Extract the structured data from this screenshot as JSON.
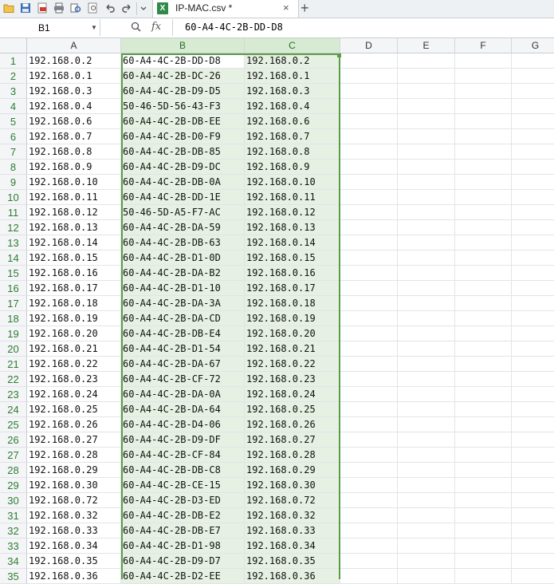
{
  "window": {
    "tab_title": "IP-MAC.csv *",
    "tab_close": "×",
    "new_tab": "+",
    "file_icon_letter": "X"
  },
  "toolbar": {
    "icons": [
      "open-folder-icon",
      "save-icon",
      "export-pdf-icon",
      "print-icon",
      "print-preview-icon",
      "find-icon",
      "undo-icon",
      "redo-icon",
      "more-dropdown-icon"
    ]
  },
  "formula_bar": {
    "name_box": "B1",
    "fx_label": "fx",
    "formula": "60-A4-4C-2B-DD-D8"
  },
  "columns": [
    "A",
    "B",
    "C",
    "D",
    "E",
    "F",
    "G"
  ],
  "selected_columns": [
    "B",
    "C"
  ],
  "rows": [
    {
      "n": "1",
      "a": "192.168.0.2",
      "b": "60-A4-4C-2B-DD-D8",
      "c": "192.168.0.2"
    },
    {
      "n": "2",
      "a": "192.168.0.1",
      "b": "60-A4-4C-2B-DC-26",
      "c": "192.168.0.1"
    },
    {
      "n": "3",
      "a": "192.168.0.3",
      "b": "60-A4-4C-2B-D9-D5",
      "c": "192.168.0.3"
    },
    {
      "n": "4",
      "a": "192.168.0.4",
      "b": "50-46-5D-56-43-F3",
      "c": "192.168.0.4"
    },
    {
      "n": "5",
      "a": "192.168.0.6",
      "b": "60-A4-4C-2B-DB-EE",
      "c": "192.168.0.6"
    },
    {
      "n": "6",
      "a": "192.168.0.7",
      "b": "60-A4-4C-2B-D0-F9",
      "c": "192.168.0.7"
    },
    {
      "n": "7",
      "a": "192.168.0.8",
      "b": "60-A4-4C-2B-DB-85",
      "c": "192.168.0.8"
    },
    {
      "n": "8",
      "a": "192.168.0.9",
      "b": "60-A4-4C-2B-D9-DC",
      "c": "192.168.0.9"
    },
    {
      "n": "9",
      "a": "192.168.0.10",
      "b": "60-A4-4C-2B-DB-0A",
      "c": "192.168.0.10"
    },
    {
      "n": "10",
      "a": "192.168.0.11",
      "b": "60-A4-4C-2B-DD-1E",
      "c": "192.168.0.11"
    },
    {
      "n": "11",
      "a": "192.168.0.12",
      "b": "50-46-5D-A5-F7-AC",
      "c": "192.168.0.12"
    },
    {
      "n": "12",
      "a": "192.168.0.13",
      "b": "60-A4-4C-2B-DA-59",
      "c": "192.168.0.13"
    },
    {
      "n": "13",
      "a": "192.168.0.14",
      "b": "60-A4-4C-2B-DB-63",
      "c": "192.168.0.14"
    },
    {
      "n": "14",
      "a": "192.168.0.15",
      "b": "60-A4-4C-2B-D1-0D",
      "c": "192.168.0.15"
    },
    {
      "n": "15",
      "a": "192.168.0.16",
      "b": "60-A4-4C-2B-DA-B2",
      "c": "192.168.0.16"
    },
    {
      "n": "16",
      "a": "192.168.0.17",
      "b": "60-A4-4C-2B-D1-10",
      "c": "192.168.0.17"
    },
    {
      "n": "17",
      "a": "192.168.0.18",
      "b": "60-A4-4C-2B-DA-3A",
      "c": "192.168.0.18"
    },
    {
      "n": "18",
      "a": "192.168.0.19",
      "b": "60-A4-4C-2B-DA-CD",
      "c": "192.168.0.19"
    },
    {
      "n": "19",
      "a": "192.168.0.20",
      "b": "60-A4-4C-2B-DB-E4",
      "c": "192.168.0.20"
    },
    {
      "n": "20",
      "a": "192.168.0.21",
      "b": "60-A4-4C-2B-D1-54",
      "c": "192.168.0.21"
    },
    {
      "n": "21",
      "a": "192.168.0.22",
      "b": "60-A4-4C-2B-DA-67",
      "c": "192.168.0.22"
    },
    {
      "n": "22",
      "a": "192.168.0.23",
      "b": "60-A4-4C-2B-CF-72",
      "c": "192.168.0.23"
    },
    {
      "n": "23",
      "a": "192.168.0.24",
      "b": "60-A4-4C-2B-DA-0A",
      "c": "192.168.0.24"
    },
    {
      "n": "24",
      "a": "192.168.0.25",
      "b": "60-A4-4C-2B-DA-64",
      "c": "192.168.0.25"
    },
    {
      "n": "25",
      "a": "192.168.0.26",
      "b": "60-A4-4C-2B-D4-06",
      "c": "192.168.0.26"
    },
    {
      "n": "26",
      "a": "192.168.0.27",
      "b": "60-A4-4C-2B-D9-DF",
      "c": "192.168.0.27"
    },
    {
      "n": "27",
      "a": "192.168.0.28",
      "b": "60-A4-4C-2B-CF-84",
      "c": "192.168.0.28"
    },
    {
      "n": "28",
      "a": "192.168.0.29",
      "b": "60-A4-4C-2B-DB-C8",
      "c": "192.168.0.29"
    },
    {
      "n": "29",
      "a": "192.168.0.30",
      "b": "60-A4-4C-2B-CE-15",
      "c": "192.168.0.30"
    },
    {
      "n": "30",
      "a": "192.168.0.72",
      "b": "60-A4-4C-2B-D3-ED",
      "c": "192.168.0.72"
    },
    {
      "n": "31",
      "a": "192.168.0.32",
      "b": "60-A4-4C-2B-DB-E2",
      "c": "192.168.0.32"
    },
    {
      "n": "32",
      "a": "192.168.0.33",
      "b": "60-A4-4C-2B-DB-E7",
      "c": "192.168.0.33"
    },
    {
      "n": "33",
      "a": "192.168.0.34",
      "b": "60-A4-4C-2B-D1-98",
      "c": "192.168.0.34"
    },
    {
      "n": "34",
      "a": "192.168.0.35",
      "b": "60-A4-4C-2B-D9-D7",
      "c": "192.168.0.35"
    },
    {
      "n": "35",
      "a": "192.168.0.36",
      "b": "60-A4-4C-2B-D2-EE",
      "c": "192.168.0.36"
    }
  ],
  "colors": {
    "selection_border": "#5b9c47",
    "selection_fill": "#e6f1e3",
    "row_number": "#2e7d32"
  }
}
